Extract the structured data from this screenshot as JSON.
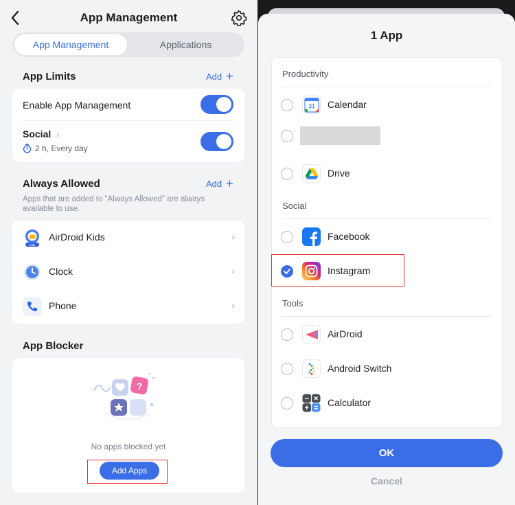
{
  "left": {
    "title": "App Management",
    "tabs": [
      {
        "label": "App Management",
        "active": true
      },
      {
        "label": "Applications",
        "active": false
      }
    ],
    "app_limits": {
      "title": "App Limits",
      "add_label": "Add",
      "rows": [
        {
          "label": "Enable App Management",
          "toggle": true
        },
        {
          "label": "Social",
          "sub": "2 h, Every day",
          "toggle": true
        }
      ]
    },
    "always_allowed": {
      "title": "Always Allowed",
      "add_label": "Add",
      "hint": "Apps that are added to \"Always Allowed\" are always available to use.",
      "apps": [
        {
          "label": "AirDroid Kids",
          "icon": "airdroid-kids-icon"
        },
        {
          "label": "Clock",
          "icon": "clock-icon"
        },
        {
          "label": "Phone",
          "icon": "phone-icon"
        }
      ],
      "kids_badge": "Kids"
    },
    "app_blocker": {
      "title": "App Blocker",
      "empty_text": "No apps blocked yet",
      "button": "Add Apps"
    }
  },
  "right": {
    "title": "1 App",
    "categories": [
      {
        "name": "Productivity",
        "apps": [
          {
            "label": "Calendar",
            "icon": "calendar-icon",
            "checked": false
          },
          {
            "label": "",
            "icon": "blurred",
            "checked": false
          },
          {
            "label": "Drive",
            "icon": "drive-icon",
            "checked": false
          }
        ]
      },
      {
        "name": "Social",
        "apps": [
          {
            "label": "Facebook",
            "icon": "facebook-icon",
            "checked": false
          },
          {
            "label": "Instagram",
            "icon": "instagram-icon",
            "checked": true
          }
        ]
      },
      {
        "name": "Tools",
        "apps": [
          {
            "label": "AirDroid",
            "icon": "airdroid-icon",
            "checked": false
          },
          {
            "label": "Android Switch",
            "icon": "android-switch-icon",
            "checked": false
          },
          {
            "label": "Calculator",
            "icon": "calculator-icon",
            "checked": false
          }
        ]
      }
    ],
    "calendar_day": "31",
    "ok": "OK",
    "cancel": "Cancel"
  },
  "colors": {
    "accent": "#3b6de6",
    "highlight": "#e03131",
    "background": "#f2f3f5"
  }
}
